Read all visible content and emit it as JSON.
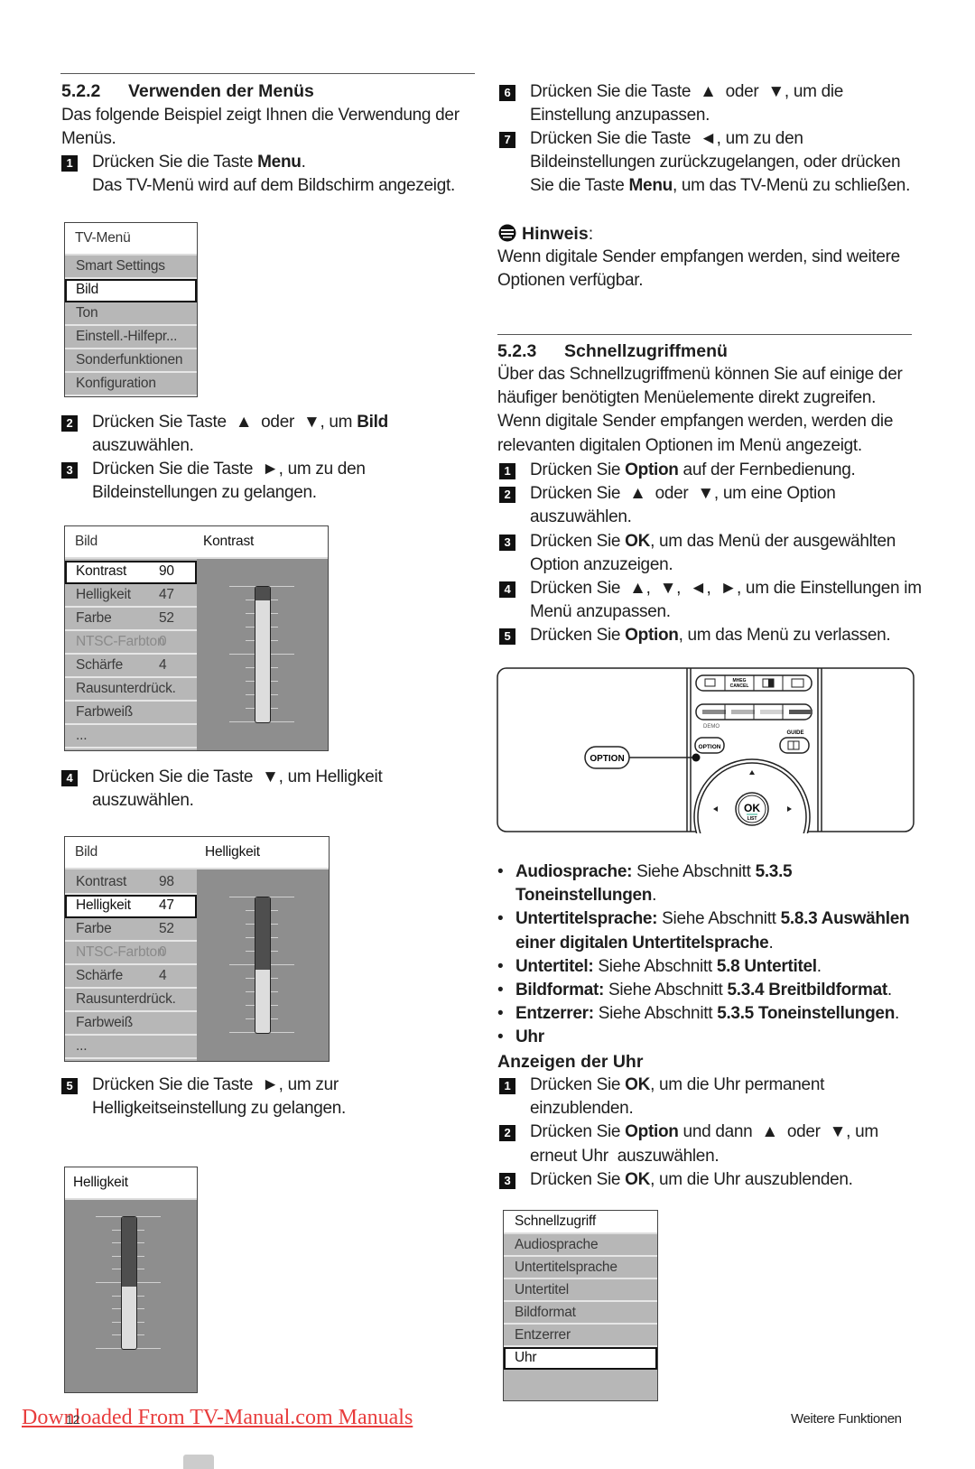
{
  "left": {
    "section_number": "5.2.2",
    "section_title": "Verwenden der Menüs",
    "intro": [
      [
        "Das folgende Beispiel zeigt Ihnen die Verwendung der\nMenüs.",
        false
      ]
    ],
    "step1": {
      "n": "1",
      "text": [
        [
          "Drücken Sie die Taste ",
          false
        ],
        [
          "Menu",
          true
        ],
        [
          ".\nDas TV-Menü wird auf dem Bildschirm angezeigt.",
          false
        ]
      ]
    },
    "menu1": {
      "title": "TV-Menü",
      "items": [
        "Smart Settings",
        "Bild",
        "Ton",
        "Einstell.-Hilfepr...",
        "Sonderfunktionen",
        "Konfiguration"
      ],
      "selected": "Bild"
    },
    "step2": {
      "n": "2",
      "text": [
        [
          "Drücken Sie Taste  ▲  oder  ▼, um ",
          false
        ],
        [
          "Bild",
          true
        ],
        [
          "\nauszuwählen.",
          false
        ]
      ]
    },
    "step3": {
      "n": "3",
      "text": [
        [
          "Drücken Sie die Taste  ►, um zu den\nBildeinstellungen zu gelangen.",
          false
        ]
      ]
    },
    "panel1": {
      "title": "Bild",
      "subtitle": "Kontrast",
      "rows": [
        {
          "label": "Kontrast",
          "value": "90"
        },
        {
          "label": "Helligkeit",
          "value": "47"
        },
        {
          "label": "Farbe",
          "value": "52"
        },
        {
          "label": "NTSC-Farbton",
          "value": "0"
        },
        {
          "label": "Schärfe",
          "value": "4"
        },
        {
          "label": "Rausunterdrück.",
          "value": ""
        },
        {
          "label": "Farbweiß",
          "value": ""
        },
        {
          "label": "...",
          "value": ""
        }
      ],
      "selected": "Kontrast",
      "slider_value": 90
    },
    "step4": {
      "n": "4",
      "text": [
        [
          "Drücken Sie die Taste  ▼, um Helligkeit\nauszuwählen.",
          false
        ]
      ]
    },
    "panel2": {
      "title": "Bild",
      "subtitle": "Helligkeit",
      "rows": [
        {
          "label": "Kontrast",
          "value": "98"
        },
        {
          "label": "Helligkeit",
          "value": "47"
        },
        {
          "label": "Farbe",
          "value": "52"
        },
        {
          "label": "NTSC-Farbton",
          "value": "0"
        },
        {
          "label": "Schärfe",
          "value": "4"
        },
        {
          "label": "Rausunterdrück.",
          "value": ""
        },
        {
          "label": "Farbweiß",
          "value": ""
        },
        {
          "label": "...",
          "value": ""
        }
      ],
      "selected": "Helligkeit",
      "slider_value": 47
    },
    "step5": {
      "n": "5",
      "text": [
        [
          "Drücken Sie die Taste  ►, um zur\nHelligkeitseinstellung zu gelangen.",
          false
        ]
      ]
    },
    "panel3": {
      "title": "Helligkeit",
      "slider_value": 47
    }
  },
  "right": {
    "step6": {
      "n": "6",
      "text": [
        [
          "Drücken Sie die Taste  ▲  oder  ▼, um die\nEinstellung anzupassen.",
          false
        ]
      ]
    },
    "step7": {
      "n": "7",
      "text": [
        [
          "Drücken Sie die Taste  ◄, um zu den\nBildeinstellungen zurückzugelangen, oder drücken\nSie die Taste ",
          false
        ],
        [
          "Menu",
          true
        ],
        [
          ", um das TV-Menü zu schließen.",
          false
        ]
      ]
    },
    "note_title": "Hinweis",
    "note_colon": ":",
    "note_text": "Wenn digitale Sender empfangen werden, sind weitere\nOptionen verfügbar.",
    "section_number": "5.2.3",
    "section_title": "Schnellzugriffmenü",
    "intro": "Über das Schnellzugriffmenü können Sie auf einige der\nhäufiger benötigten Menüelemente direkt zugreifen.\nWenn digitale Sender empfangen werden, werden die\nrelevanten digitalen Optionen im Menü angezeigt.",
    "steps": [
      {
        "n": "1",
        "text": [
          [
            "Drücken Sie ",
            false
          ],
          [
            "Option",
            true
          ],
          [
            " auf der Fernbedienung.",
            false
          ]
        ]
      },
      {
        "n": "2",
        "text": [
          [
            "Drücken Sie  ▲  oder  ▼, um eine Option\nauszuwählen.",
            false
          ]
        ]
      },
      {
        "n": "3",
        "text": [
          [
            "Drücken Sie ",
            false
          ],
          [
            "OK",
            true
          ],
          [
            ", um das Menü der ausgewählten\nOption anzuzeigen.",
            false
          ]
        ]
      },
      {
        "n": "4",
        "text": [
          [
            "Drücken Sie  ▲,  ▼,  ◄,  ►, um die Einstellungen im\nMenü anzupassen.",
            false
          ]
        ]
      },
      {
        "n": "5",
        "text": [
          [
            "Drücken Sie ",
            false
          ],
          [
            "Option",
            true
          ],
          [
            ", um das Menü zu verlassen.",
            false
          ]
        ]
      }
    ],
    "remote": {
      "option_callout": "OPTION",
      "option_key": "OPTION",
      "mheg_line1": "MHEG",
      "mheg_line2": "CANCEL",
      "demo": "DEMO",
      "guide": "GUIDE",
      "ok": "OK",
      "list": "LIST",
      "color_keys": [
        "#8a8a8a",
        "#b4b4b4",
        "#d2d2d2",
        "#555555"
      ]
    },
    "bullets": [
      [
        [
          "Audiosprache:",
          true
        ],
        [
          " Siehe Abschnitt ",
          false
        ],
        [
          "5.3.5 Toneinstellungen",
          true
        ],
        [
          ".",
          false
        ]
      ],
      [
        [
          "Untertitelsprache:",
          true
        ],
        [
          " Siehe Abschnitt ",
          false
        ],
        [
          "5.8.3 Auswählen\neiner digitalen Untertitelsprache",
          true
        ],
        [
          ".",
          false
        ]
      ],
      [
        [
          "Untertitel:",
          true
        ],
        [
          " Siehe Abschnitt ",
          false
        ],
        [
          "5.8 Untertitel",
          true
        ],
        [
          ".",
          false
        ]
      ],
      [
        [
          "Bildformat:",
          true
        ],
        [
          " Siehe Abschnitt ",
          false
        ],
        [
          "5.3.4 Breitbildformat",
          true
        ],
        [
          ".",
          false
        ]
      ],
      [
        [
          "Entzerrer:",
          true
        ],
        [
          " Siehe Abschnitt ",
          false
        ],
        [
          "5.3.5 Toneinstellungen",
          true
        ],
        [
          ".",
          false
        ]
      ],
      [
        [
          "Uhr",
          true
        ]
      ]
    ],
    "clock_title": "Anzeigen der Uhr",
    "clock_steps": [
      {
        "n": "1",
        "text": [
          [
            "Drücken Sie ",
            false
          ],
          [
            "OK",
            true
          ],
          [
            ", um die Uhr permanent\neinzublenden.",
            false
          ]
        ]
      },
      {
        "n": "2",
        "text": [
          [
            "Drücken Sie ",
            false
          ],
          [
            "Option",
            true
          ],
          [
            " und dann  ▲  oder  ▼, um\nerneut Uhr  auszuwählen.",
            false
          ]
        ]
      },
      {
        "n": "3",
        "text": [
          [
            "Drücken Sie ",
            false
          ],
          [
            "OK",
            true
          ],
          [
            ", um die Uhr auszublenden.",
            false
          ]
        ]
      }
    ],
    "quick_menu": {
      "title": "Schnellzugriff",
      "items": [
        "Audiosprache",
        "Untertitelsprache",
        "Untertitel",
        "Bildformat",
        "Entzerrer",
        "Uhr"
      ],
      "selected": "Uhr"
    }
  },
  "footer": {
    "download_link": "Downloaded From TV-Manual.com Manuals",
    "page_number": "12",
    "chapter": "Weitere Funktionen"
  }
}
